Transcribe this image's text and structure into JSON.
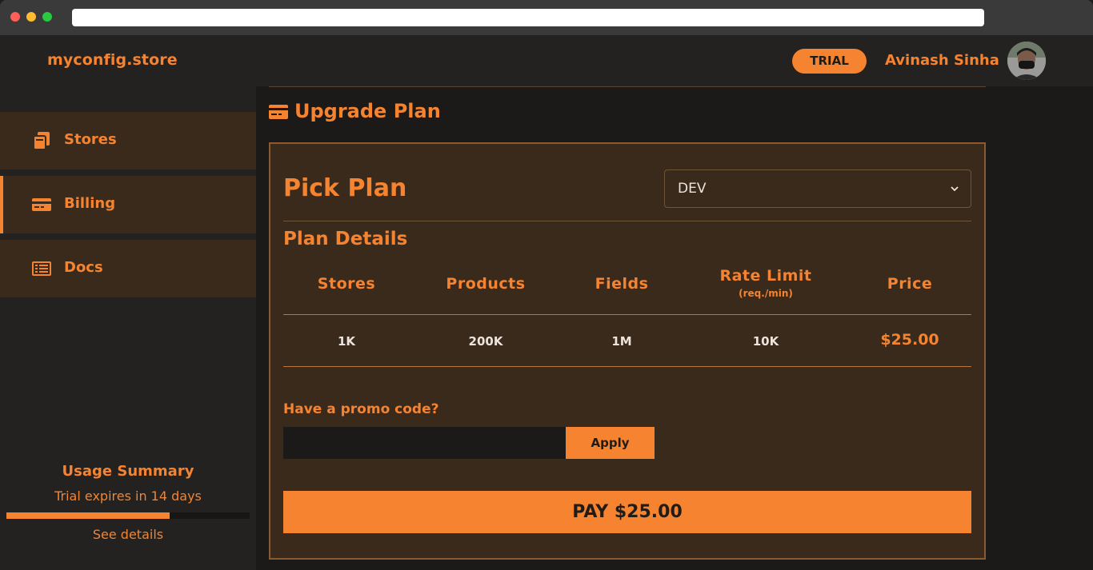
{
  "header": {
    "brand": "myconfig.store",
    "badge": "TRIAL",
    "user_name": "Avinash Sinha"
  },
  "sidebar": {
    "items": [
      {
        "label": "Stores",
        "icon": "copy-icon",
        "active": false
      },
      {
        "label": "Billing",
        "icon": "credit-card-icon",
        "active": true
      },
      {
        "label": "Docs",
        "icon": "list-alt-icon",
        "active": false
      }
    ],
    "usage": {
      "title": "Usage Summary",
      "subtitle": "Trial expires in 14 days",
      "progress_percent": 67,
      "link": "See details"
    }
  },
  "main": {
    "title": "Upgrade Plan",
    "title_icon": "credit-card-icon",
    "pick_plan_label": "Pick Plan",
    "selected_plan": "DEV",
    "plan_details_label": "Plan Details",
    "table": {
      "headers": [
        "Stores",
        "Products",
        "Fields",
        "Rate Limit",
        "Price"
      ],
      "header_sub": {
        "Rate Limit": "(req./min)"
      },
      "row": [
        "1K",
        "200K",
        "1M",
        "10K",
        "$25.00"
      ]
    },
    "promo": {
      "label": "Have a promo code?",
      "value": "",
      "placeholder": "",
      "apply_label": "Apply"
    },
    "pay_label": "PAY $25.00"
  },
  "colors": {
    "accent": "#f5832f",
    "panel": "#3a2a1c",
    "background": "#1b1a18"
  }
}
